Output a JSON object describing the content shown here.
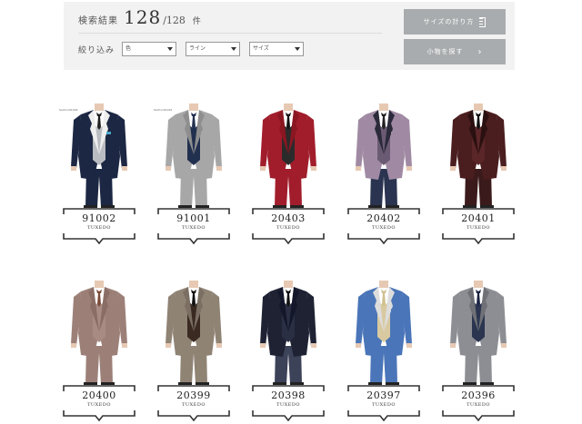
{
  "search": {
    "count_label": "検索結果",
    "count": "128",
    "total": "/128",
    "unit": "件",
    "filter_label": "絞り込み",
    "filters": [
      {
        "selected": "色"
      },
      {
        "selected": "ライン"
      },
      {
        "selected": "サイズ"
      }
    ]
  },
  "buttons": {
    "size_guide": "サイズの計り方",
    "small_items": "小物を探す"
  },
  "products": [
    {
      "code": "91002",
      "type": "TUXEDO",
      "tag": "Sachoo91002",
      "jacket": "#1c2743",
      "lapel": "#eeeeee",
      "vest": "#b9bcc0",
      "shirt": "#ffffff",
      "pants": "#1c2743",
      "tie": "#222222",
      "pocket": "#4aa6c9"
    },
    {
      "code": "91001",
      "type": "TUXEDO",
      "tag": "Sachoo91001",
      "jacket": "#a7a7a7",
      "lapel": "#8e8e8e",
      "vest": "#22304f",
      "shirt": "#ffffff",
      "pants": "#a7a7a7",
      "tie": "#22304f",
      "pocket": "#a7a7a7"
    },
    {
      "code": "20403",
      "type": "TUXEDO",
      "jacket": "#a11d2b",
      "lapel": "#8a1622",
      "vest": "#2b2b2b",
      "shirt": "#ffffff",
      "pants": "#a11d2b",
      "tie": "#111111",
      "pocket": "#a11d2b"
    },
    {
      "code": "20402",
      "type": "TUXEDO",
      "jacket": "#a08aa3",
      "lapel": "#2a2a3a",
      "vest": "#6b5a73",
      "shirt": "#ffffff",
      "pants": "#2a3450",
      "tie": "#222222",
      "pocket": "#a08aa3"
    },
    {
      "code": "20401",
      "type": "TUXEDO",
      "jacket": "#4a1d1f",
      "lapel": "#2a1010",
      "vest": "#5a2628",
      "shirt": "#ffffff",
      "pants": "#3b1a1b",
      "tie": "#111111",
      "pocket": "#4a1d1f"
    },
    {
      "code": "20400",
      "type": "TUXEDO",
      "jacket": "#9c8078",
      "lapel": "#8a6e66",
      "vest": "#a88c84",
      "shirt": "#ffffff",
      "pants": "#9c8078",
      "tie": "#7a4a3a",
      "pocket": "#9c8078"
    },
    {
      "code": "20399",
      "type": "TUXEDO",
      "jacket": "#8f8374",
      "lapel": "#7a6f62",
      "vest": "#3a2a22",
      "shirt": "#ffffff",
      "pants": "#8f8374",
      "tie": "#111111",
      "pocket": "#8f8374"
    },
    {
      "code": "20398",
      "type": "TUXEDO",
      "jacket": "#1e2233",
      "lapel": "#14172a",
      "vest": "#2a2f44",
      "shirt": "#ffffff",
      "pants": "#3c4258",
      "tie": "#111111",
      "pocket": "#1e2233"
    },
    {
      "code": "20397",
      "type": "TUXEDO",
      "jacket": "#4a75b8",
      "lapel": "#dddddd",
      "vest": "#d8c9a0",
      "shirt": "#ffffff",
      "pants": "#4a75b8",
      "tie": "#cfc08f",
      "pocket": "#4a75b8"
    },
    {
      "code": "20396",
      "type": "TUXEDO",
      "jacket": "#8c8e93",
      "lapel": "#6f7176",
      "vest": "#2b3550",
      "shirt": "#ffffff",
      "pants": "#8c8e93",
      "tie": "#1b2440",
      "pocket": "#8c8e93"
    }
  ]
}
